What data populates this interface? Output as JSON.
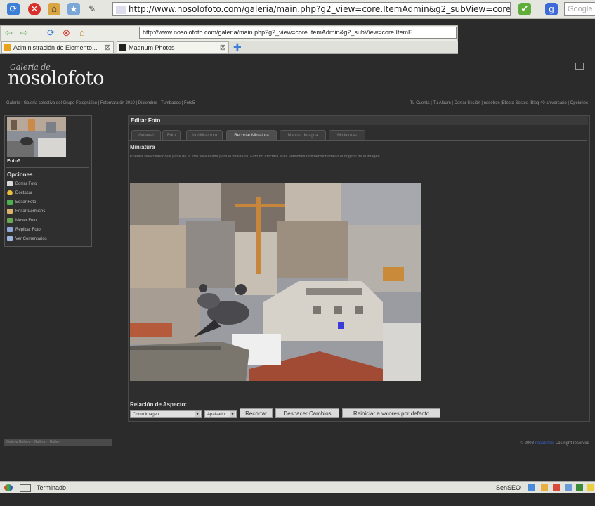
{
  "browser": {
    "url_main": "http://www.nosolofoto.com/galeria/main.php?g2_view=core.ItemAdmin&g2_subView=core.ItemE",
    "url_secondary": "http://www.nosolofoto.com/galeria/main.php?g2_view=core.ItemAdmin&g2_subView=core.ItemE",
    "search_placeholder": "Google",
    "tabs": [
      {
        "label": "Administración de Elemento..."
      },
      {
        "label": "Magnum Photos"
      }
    ],
    "status_text": "Terminado",
    "status_addon": "SenSEO"
  },
  "site": {
    "logo_small": "Galería de",
    "logo": "nosolofoto",
    "breadcrumb": "Galería | Galería colectiva del Grupo Fotográfico | Fotomaratón 2010 | Diciembre - Tumbados | Foto5",
    "user_nav": "Tu Cuenta | Tu Álbum | Cerrar Sesión | nosotros |Efecto Sestea |Blog 40 aniversario | Opciones"
  },
  "sidebar": {
    "thumb_label": "Foto5",
    "options_heading": "Opciones",
    "options": [
      {
        "label": "Borrar Foto",
        "color": "#d9d9d9"
      },
      {
        "label": "Destacar",
        "color": "#e8c040"
      },
      {
        "label": "Editar Foto",
        "color": "#4caf50"
      },
      {
        "label": "Editar Permisos",
        "color": "#d9b36c"
      },
      {
        "label": "Mover Foto",
        "color": "#6aa84f"
      },
      {
        "label": "Replicar Foto",
        "color": "#8fa8d8"
      },
      {
        "label": "Ver Comentarios",
        "color": "#9fb6e0"
      }
    ]
  },
  "editor": {
    "title": "Editar Foto",
    "tabs": [
      {
        "label": "General"
      },
      {
        "label": "Foto"
      },
      {
        "label": "Modificar foto"
      },
      {
        "label": "Recortar Miniatura"
      },
      {
        "label": "Marcas de agua"
      },
      {
        "label": "Miniaturas"
      }
    ],
    "active_tab": "Recortar Miniatura",
    "section_title": "Miniatura",
    "section_desc": "Puedes seleccionar que parte de la foto será usada para la miniatura. Esto no afectará a las versiones redimensionadas o el original de la imagen.",
    "aspect_label": "Relación de Aspecto:",
    "aspect_select": "Como imagen",
    "orientation_select": "Apaisado",
    "buttons": {
      "crop": "Recortar",
      "undo": "Deshacer Cambios",
      "reset": "Reiniciar a valores por defecto"
    }
  },
  "footer": {
    "left": "Galería Gallery ·· Gallery ·· Gallery",
    "right_prefix": "© 2008",
    "right_link": "nosolofoto",
    "right_suffix": "Los right reserved"
  },
  "colors": {
    "page_bg": "#2b2b2b",
    "panel_bg": "#2e2e2e",
    "chrome_bg": "#e6e6e0"
  }
}
